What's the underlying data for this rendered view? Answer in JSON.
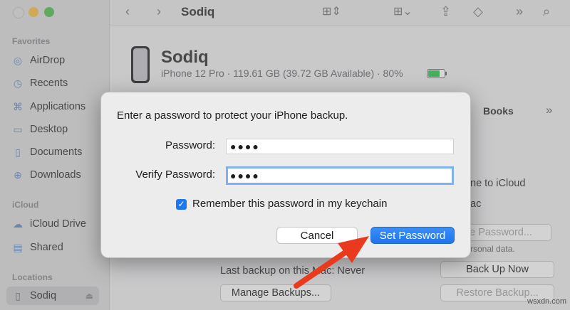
{
  "toolbar": {
    "title": "Sodiq"
  },
  "sidebar": {
    "favorites_header": "Favorites",
    "favorites": [
      {
        "label": "AirDrop",
        "icon": "airdrop-icon"
      },
      {
        "label": "Recents",
        "icon": "clock-icon"
      },
      {
        "label": "Applications",
        "icon": "applications-icon"
      },
      {
        "label": "Desktop",
        "icon": "desktop-icon"
      },
      {
        "label": "Documents",
        "icon": "document-icon"
      },
      {
        "label": "Downloads",
        "icon": "download-icon"
      }
    ],
    "icloud_header": "iCloud",
    "icloud": [
      {
        "label": "iCloud Drive",
        "icon": "cloud-icon"
      },
      {
        "label": "Shared",
        "icon": "shared-folder-icon"
      }
    ],
    "locations_header": "Locations",
    "locations": [
      {
        "label": "Sodiq",
        "icon": "phone-icon",
        "active": true
      }
    ]
  },
  "device": {
    "name": "Sodiq",
    "info": "iPhone 12 Pro · 119.61 GB (39.72 GB Available) · 80%",
    "battery_level": 0.8
  },
  "background": {
    "tab_books": "Books",
    "icloud_text": "ne to iCloud",
    "mac_text": "ac",
    "change_password": "ge Password...",
    "personal_data": "rsonal data.",
    "last_backup": "Last backup on this Mac:  Never",
    "back_up_now": "Back Up Now",
    "manage_backups": "Manage Backups...",
    "restore_backup": "Restore Backup..."
  },
  "dialog": {
    "prompt": "Enter a password to protect your iPhone backup.",
    "password_label": "Password:",
    "password_value": "●●●●",
    "verify_label": "Verify Password:",
    "verify_value": "●●●●",
    "remember_label": "Remember this password in my keychain",
    "remember_checked": true,
    "cancel": "Cancel",
    "set_password": "Set Password"
  },
  "colors": {
    "accent": "#1f74ec",
    "annotation_arrow": "#ea3a1e"
  },
  "watermark": "wsxdn.com"
}
